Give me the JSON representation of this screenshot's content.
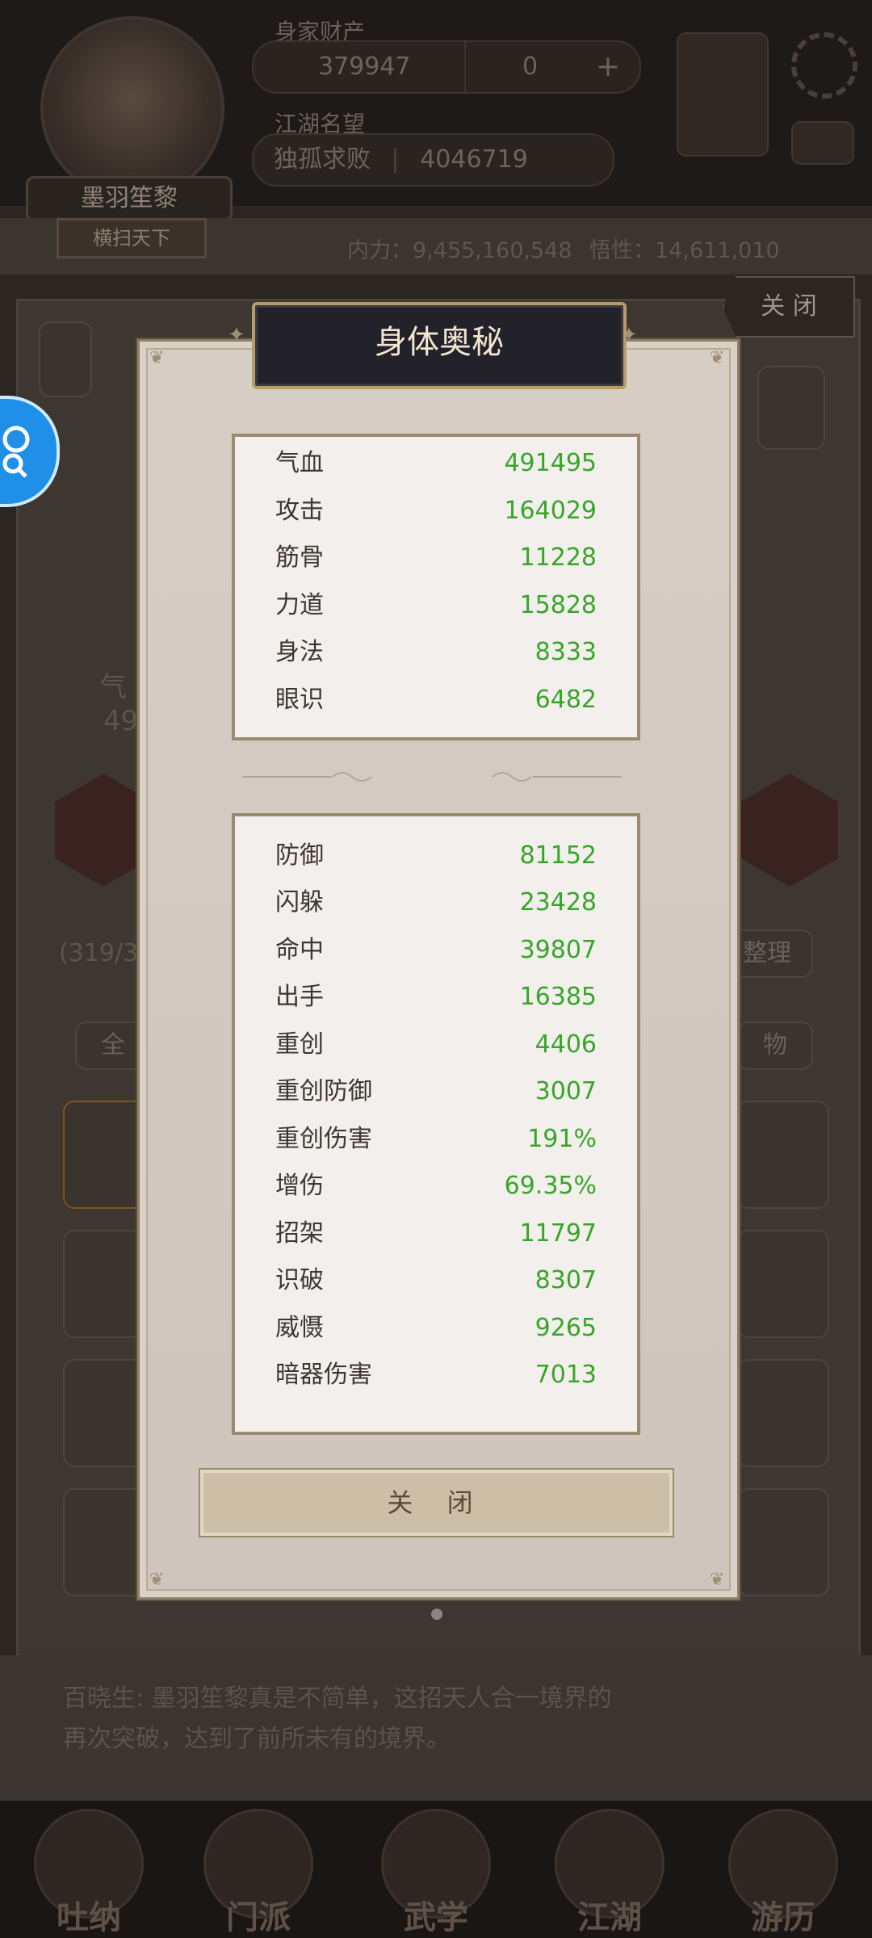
{
  "background": {
    "resource_label": "身家财产",
    "gold_value": "379947",
    "gem_value": "0",
    "reputation_label": "江湖名望",
    "reputation_title": "独孤求败",
    "reputation_value": "4046719",
    "player_name": "墨羽笙黎",
    "player_tag": "横扫天下",
    "neili": "内力：9,455,160,548",
    "wuxing": "悟性：14,611,010",
    "close_label": "关 闭",
    "count_text": "(319/3",
    "sort_label": "整理",
    "tab_all": "全",
    "tab_item": "物",
    "qi_label": "气",
    "qi_value": "49",
    "messages": [
      "百晓生: 墨羽笙黎真是不简单，这招天人合一境界的",
      "再次突破，达到了前所未有的境界。"
    ],
    "nav": [
      "吐纳",
      "门派",
      "武学",
      "江湖",
      "游历"
    ]
  },
  "modal": {
    "title": "身体奥秘",
    "basic_stats": [
      {
        "name": "气血",
        "value": "491495"
      },
      {
        "name": "攻击",
        "value": "164029"
      },
      {
        "name": "筋骨",
        "value": "11228"
      },
      {
        "name": "力道",
        "value": "15828"
      },
      {
        "name": "身法",
        "value": "8333"
      },
      {
        "name": "眼识",
        "value": "6482"
      }
    ],
    "combat_stats": [
      {
        "name": "防御",
        "value": "81152"
      },
      {
        "name": "闪躲",
        "value": "23428"
      },
      {
        "name": "命中",
        "value": "39807"
      },
      {
        "name": "出手",
        "value": "16385"
      },
      {
        "name": "重创",
        "value": "4406"
      },
      {
        "name": "重创防御",
        "value": "3007"
      },
      {
        "name": "重创伤害",
        "value": "191%"
      },
      {
        "name": "增伤",
        "value": "69.35%"
      },
      {
        "name": "招架",
        "value": "11797"
      },
      {
        "name": "识破",
        "value": "8307"
      },
      {
        "name": "威慑",
        "value": "9265"
      },
      {
        "name": "暗器伤害",
        "value": "7013"
      }
    ],
    "close_button": "关 闭"
  },
  "colors": {
    "stat_value": "#37a628",
    "title_bg": "#23222b",
    "accent_gold": "#b89b6b",
    "float_button": "#1f8fe8"
  }
}
